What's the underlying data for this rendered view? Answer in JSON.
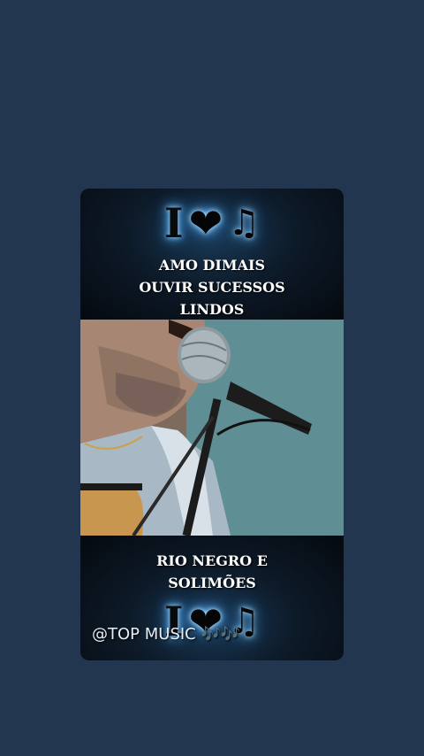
{
  "top_banner": {
    "i_letter": "I",
    "heart_glyph": "❤",
    "note_glyph": "♫",
    "lines": [
      "AMO DIMAIS",
      "OUVIR SUCESSOS",
      "LINDOS"
    ]
  },
  "bottom_banner": {
    "lines": [
      "RIO NEGRO E",
      "SOLIMÕES"
    ],
    "i_letter": "I",
    "heart_glyph": "❤",
    "note_glyph": "♫"
  },
  "watermark": {
    "text": "@TOP MUSIC",
    "notes": "🎶🎶"
  },
  "colors": {
    "background": "#22374f",
    "glow": "#6cc0ff",
    "text": "#ffffff"
  }
}
